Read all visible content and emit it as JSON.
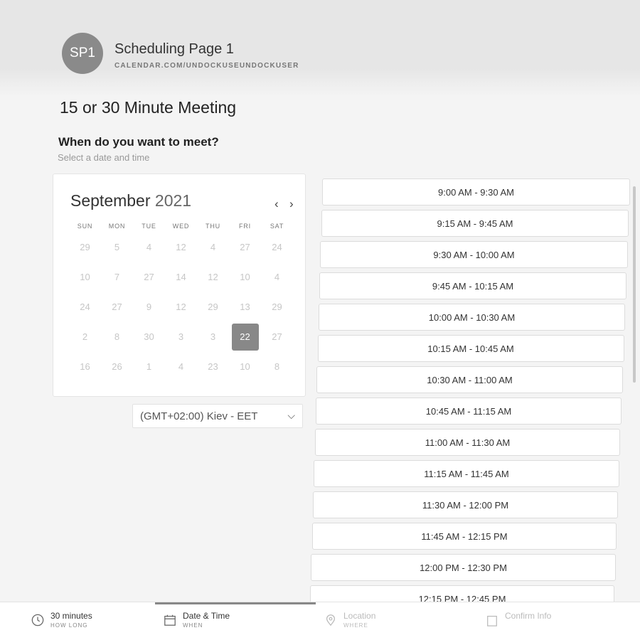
{
  "header": {
    "avatar_initials": "SP1",
    "title": "Scheduling Page 1",
    "url": "CALENDAR.COM/UNDOCKUSEUNDOCKUSER"
  },
  "meeting": {
    "title": "15 or 30 Minute Meeting",
    "prompt": "When do you want to meet?",
    "subprompt": "Select a date and time"
  },
  "calendar": {
    "month": "September",
    "year": "2021",
    "prev_icon": "chevron-left-icon",
    "next_icon": "chevron-right-icon",
    "weekdays": [
      "SUN",
      "MON",
      "TUE",
      "WED",
      "THU",
      "FRI",
      "SAT"
    ],
    "weeks": [
      [
        "29",
        "5",
        "4",
        "12",
        "4",
        "27",
        "24"
      ],
      [
        "10",
        "7",
        "27",
        "14",
        "12",
        "10",
        "4"
      ],
      [
        "24",
        "27",
        "9",
        "12",
        "29",
        "13",
        "29"
      ],
      [
        "2",
        "8",
        "30",
        "3",
        "3",
        "22",
        "27"
      ],
      [
        "16",
        "26",
        "1",
        "4",
        "23",
        "10",
        "8"
      ]
    ],
    "selected_day": "22"
  },
  "timezone": {
    "value": "(GMT+02:00) Kiev - EET",
    "icon": "chevron-down-icon"
  },
  "time_slots": [
    "9:00 AM - 9:30 AM",
    "9:15 AM - 9:45 AM",
    "9:30 AM - 10:00 AM",
    "9:45 AM - 10:15 AM",
    "10:00 AM - 10:30 AM",
    "10:15 AM - 10:45 AM",
    "10:30 AM - 11:00 AM",
    "10:45 AM - 11:15 AM",
    "11:00 AM - 11:30 AM",
    "11:15 AM - 11:45 AM",
    "11:30 AM - 12:00 PM",
    "11:45 AM - 12:15 PM",
    "12:00 PM - 12:30 PM",
    "12:15 PM - 12:45 PM"
  ],
  "steps": [
    {
      "label": "30 minutes",
      "sub": "HOW LONG",
      "icon": "clock-icon",
      "state": "done"
    },
    {
      "label": "Date & Time",
      "sub": "WHEN",
      "icon": "calendar-icon",
      "state": "active"
    },
    {
      "label": "Location",
      "sub": "WHERE",
      "icon": "map-pin-icon",
      "state": "pending"
    },
    {
      "label": "Confirm Info",
      "sub": "",
      "icon": "clipboard-icon",
      "state": "pending"
    }
  ]
}
